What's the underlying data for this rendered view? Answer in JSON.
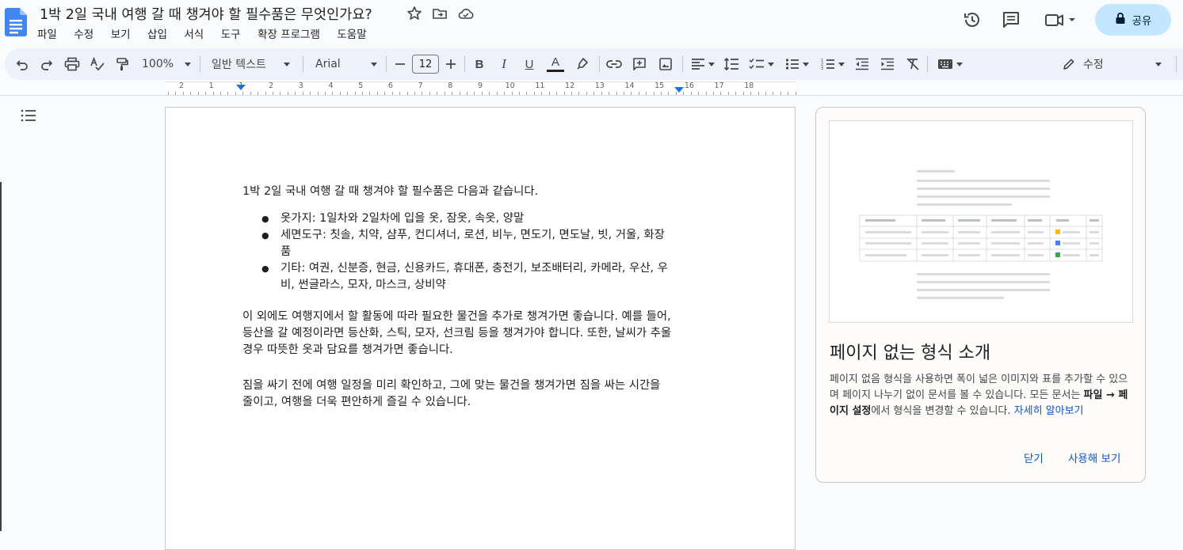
{
  "document": {
    "title": "1박 2일 국내 여행 갈 때 챙겨야 할 필수품은 무엇인가요?"
  },
  "menu": [
    "파일",
    "수정",
    "보기",
    "삽입",
    "서식",
    "도구",
    "확장 프로그램",
    "도움말"
  ],
  "header": {
    "share_label": "공유"
  },
  "toolbar": {
    "zoom": "100%",
    "style": "일반 텍스트",
    "font": "Arial",
    "font_size": "12",
    "mode": "수정"
  },
  "ruler": {
    "numbers": [
      "2",
      "1",
      "1",
      "2",
      "3",
      "4",
      "5",
      "6",
      "7",
      "8",
      "9",
      "10",
      "11",
      "12",
      "13",
      "14",
      "15",
      "16",
      "17",
      "18"
    ]
  },
  "body": {
    "intro": "1박 2일 국내 여행 갈 때 챙겨야 할 필수품은 다음과 같습니다.",
    "items": [
      "옷가지: 1일차와 2일차에 입을 옷, 잠옷, 속옷, 양말",
      "세면도구: 칫솔, 치약, 샴푸, 컨디셔너, 로션, 비누, 면도기, 면도날, 빗, 거울, 화장품",
      "기타: 여권, 신분증, 현금, 신용카드, 휴대폰, 충전기, 보조배터리, 카메라, 우산, 우비, 썬글라스, 모자, 마스크, 상비약"
    ],
    "paragraph2": "이 외에도 여행지에서 할 활동에 따라 필요한 물건을 추가로 챙겨가면 좋습니다. 예를 들어, 등산을 갈 예정이라면 등산화, 스틱, 모자, 선크림 등을 챙겨가야 합니다. 또한, 날씨가 추울 경우 따뜻한 옷과 담요를 챙겨가면 좋습니다.",
    "paragraph3": "짐을 싸기 전에 여행 일정을 미리 확인하고, 그에 맞는 물건을 챙겨가면 짐을 싸는 시간을 줄이고, 여행을 더욱 편안하게 즐길 수 있습니다."
  },
  "panel": {
    "title": "페이지 없는 형식 소개",
    "desc_1": "페이지 없음 형식을 사용하면 폭이 넓은 이미지와 표를 추가할 수 있으며 페이지 나누기 없이 문서를 볼 수 있습니다. 모든 문서는 ",
    "desc_bold": "파일 → 페이지 설정",
    "desc_2": "에서 형식을 변경할 수 있습니다. ",
    "learn_more": "자세히 알아보기",
    "close_label": "닫기",
    "try_label": "사용해 보기"
  },
  "colors": {
    "accent": "#0b57d0",
    "share_bg": "#c2e7ff",
    "toolbar_bg": "#edf2fa",
    "docs_blue": "#4285f4"
  }
}
